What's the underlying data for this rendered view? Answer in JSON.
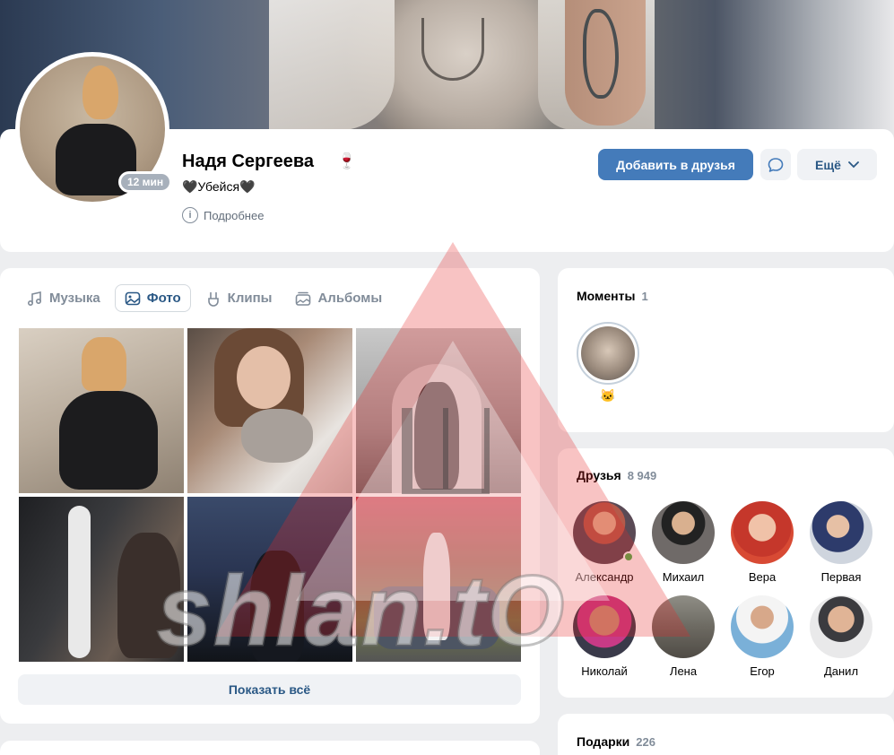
{
  "profile": {
    "name": "Надя Сергеева",
    "name_emoji": "🍷",
    "status": "🖤Убейся🖤",
    "more_info": "Подробнее",
    "online": "12 мин"
  },
  "actions": {
    "add_friend": "Добавить в друзья",
    "more": "Ещё"
  },
  "media": {
    "tabs": [
      {
        "label": "Музыка",
        "icon": "music-icon",
        "active": false
      },
      {
        "label": "Фото",
        "icon": "photo-icon",
        "active": true
      },
      {
        "label": "Клипы",
        "icon": "clips-icon",
        "active": false
      },
      {
        "label": "Альбомы",
        "icon": "albums-icon",
        "active": false
      }
    ],
    "show_all": "Показать всё"
  },
  "moments": {
    "title": "Моменты",
    "count": "1",
    "emoji": "🐱"
  },
  "friends": {
    "title": "Друзья",
    "count": "8 949",
    "items": [
      {
        "name": "Александр",
        "online": true
      },
      {
        "name": "Михаил",
        "online": false
      },
      {
        "name": "Вера",
        "online": false
      },
      {
        "name": "Первая",
        "online": false
      },
      {
        "name": "Николай",
        "online": false
      },
      {
        "name": "Лена",
        "online": false
      },
      {
        "name": "Егор",
        "online": false
      },
      {
        "name": "Данил",
        "online": false
      }
    ]
  },
  "gifts": {
    "title": "Подарки",
    "count": "226"
  },
  "watermark": {
    "text": "shlan.tO"
  },
  "colors": {
    "primary_button": "#447bba",
    "link": "#2a5885",
    "muted": "#818c99",
    "online": "#4bb34b"
  }
}
